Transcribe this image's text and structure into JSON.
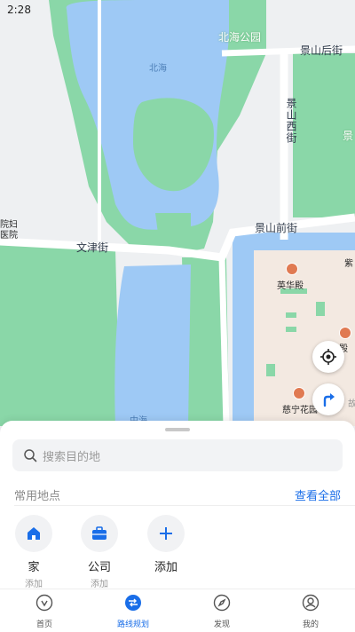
{
  "status": {
    "time": "2:28"
  },
  "map": {
    "labels": {
      "beihai_park": "北海公园",
      "beihai": "北海",
      "jingshan_back": "景山后街",
      "jingshan_west": "景山西街",
      "jing_edge": "景",
      "wenjin": "文津街",
      "jingshan_front": "景山前街",
      "hospital_1": "院妇",
      "hospital_2": "医院",
      "yinghua": "英华殿",
      "zi": "紫",
      "xinxin": "心殿",
      "cining": "慈宁花园",
      "gu": "故",
      "zhonghai": "中海"
    },
    "colors": {
      "water": "#9ec9f5",
      "park": "#8ad7a8",
      "land": "#eef0f2",
      "palace": "#f3e9e1"
    }
  },
  "sheet": {
    "search_placeholder": "搜索目的地",
    "section_title": "常用地点",
    "see_all": "查看全部",
    "places": [
      {
        "name": "家",
        "sub": "添加",
        "icon": "home-icon"
      },
      {
        "name": "公司",
        "sub": "添加",
        "icon": "briefcase-icon"
      },
      {
        "name": "添加",
        "sub": "",
        "icon": "plus-icon"
      }
    ]
  },
  "tabs": [
    {
      "label": "首页",
      "icon": "map-pin-icon"
    },
    {
      "label": "路线规划",
      "icon": "route-icon",
      "active": true
    },
    {
      "label": "发现",
      "icon": "compass-icon"
    },
    {
      "label": "我的",
      "icon": "user-icon"
    }
  ],
  "accent": "#1a6ee8"
}
